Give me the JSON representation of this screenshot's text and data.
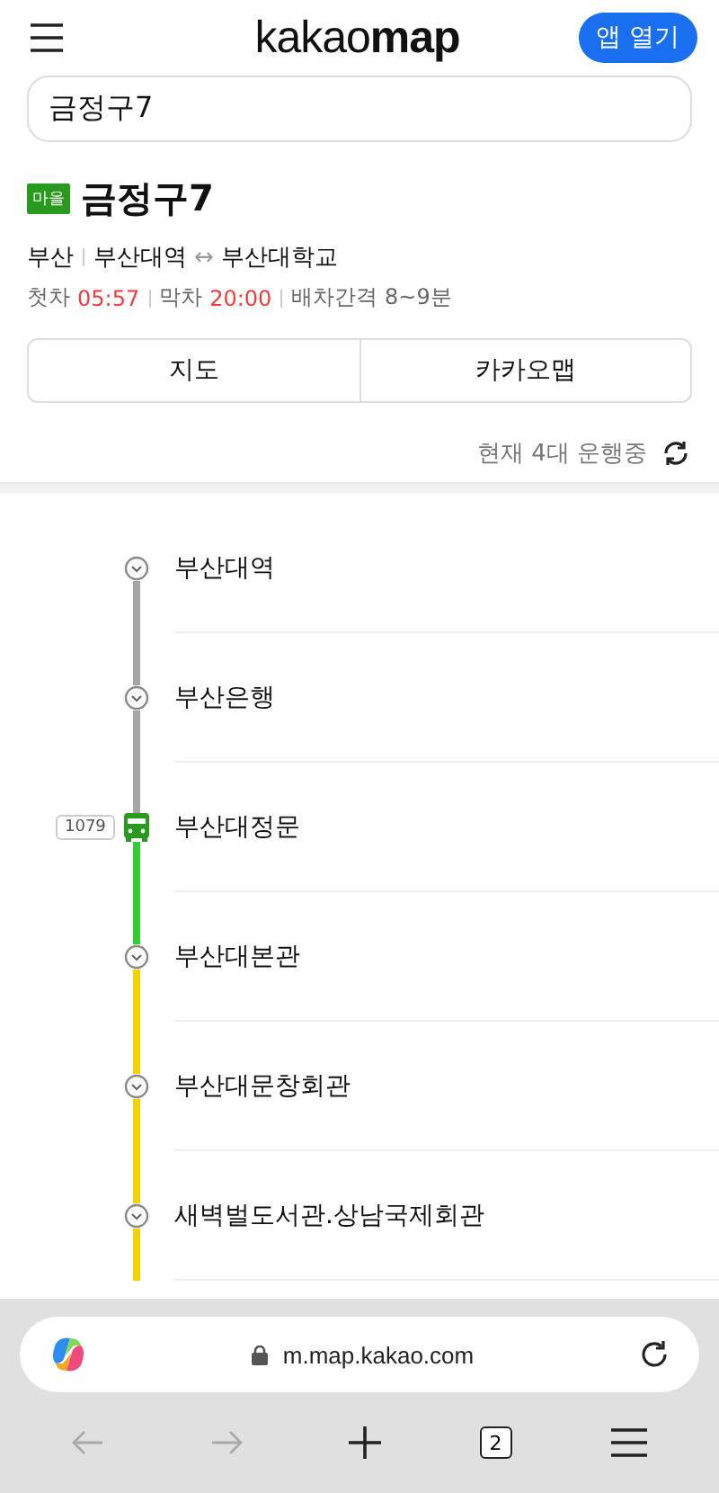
{
  "header": {
    "logo_light": "kakao",
    "logo_bold": "map",
    "open_app_button": "앱 열기"
  },
  "search": {
    "value": "금정구7"
  },
  "route": {
    "badge": "마을",
    "name": "금정구7",
    "region": "부산",
    "from": "부산대역",
    "arrow": "↔",
    "to": "부산대학교",
    "first_label": "첫차",
    "first_time": "05:57",
    "last_label": "막차",
    "last_time": "20:00",
    "interval": "배차간격 8~9분"
  },
  "view_tabs": [
    {
      "label": "지도"
    },
    {
      "label": "카카오맵"
    }
  ],
  "status": {
    "text": "현재 4대 운행중"
  },
  "stops": [
    {
      "name": "부산대역",
      "color": "#a6a6a6",
      "kind": "stop"
    },
    {
      "name": "부산은행",
      "color": "#a6a6a6",
      "kind": "stop"
    },
    {
      "name": "부산대정문",
      "color": "#33cc33",
      "kind": "bus",
      "bus_number": "1079"
    },
    {
      "name": "부산대본관",
      "color": "#f2d200",
      "kind": "stop"
    },
    {
      "name": "부산대문창회관",
      "color": "#f2d200",
      "kind": "stop"
    },
    {
      "name": "새벽벌도서관.상남국제회관",
      "color": "#f2d200",
      "kind": "stop"
    }
  ],
  "browser": {
    "url": "m.map.kakao.com",
    "tab_count": "2",
    "back_disabled": true,
    "forward_disabled": true
  }
}
